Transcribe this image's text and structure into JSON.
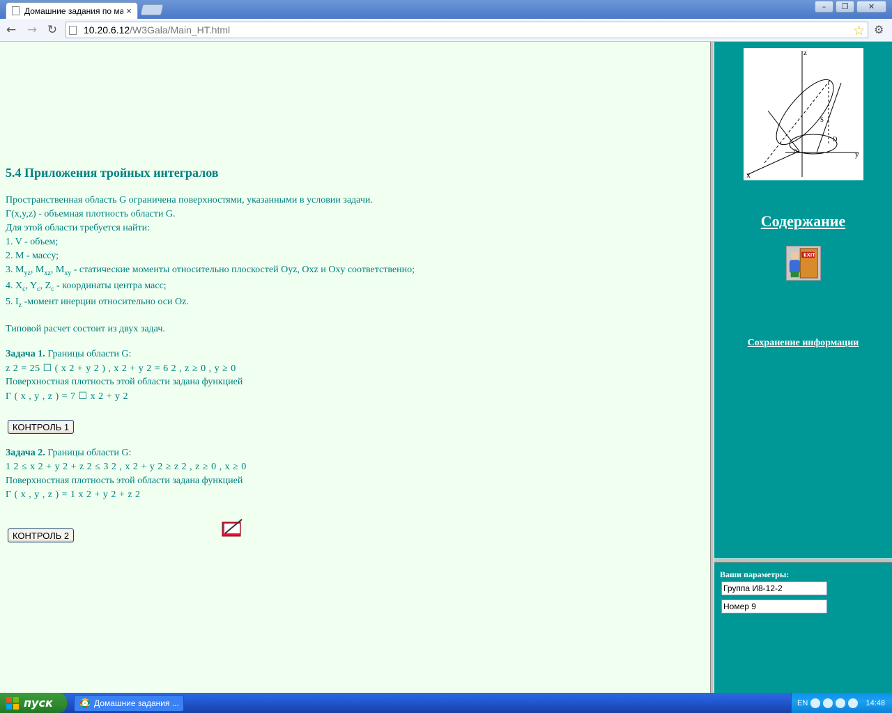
{
  "browser": {
    "tab_title": "Домашние задания по мате",
    "tab_close": "×",
    "url_host": "10.20.6.12",
    "url_path": "/W3Gala/Main_HT.html",
    "window_buttons": [
      "–",
      "❐",
      "✕"
    ]
  },
  "main": {
    "heading": "5.4 Приложения тройных интегралов",
    "intro": [
      "Пространственная область G ограничена поверхностями, указанными в условии задачи.",
      "Г(x,y,z) - объемная плотность области G.",
      "Для этой области требуется найти:",
      "1. V - объем;",
      "2. M - массу;"
    ],
    "item3": {
      "prefix": "3. M",
      "s1": "yz",
      "mid1": ", M",
      "s2": "xz",
      "mid2": ", M",
      "s3": "xy",
      "suffix": " - статические моменты относительно плоскостей Oyz, Oxz и Oxy соответственно;"
    },
    "item4": {
      "prefix": "4. X",
      "s1": "c",
      "mid1": ", Y",
      "s2": "c",
      "mid2": ", Z",
      "s3": "c",
      "suffix": " - координаты центра масс;"
    },
    "item5": {
      "prefix": "5. I",
      "s1": "z",
      "suffix": " -момент инерции относительно оси Oz."
    },
    "summary": "Типовой расчет состоит из двух задач.",
    "task1": {
      "label": "Задача 1.",
      "boundary_text": " Границы области G:",
      "equation": "z 2 = 25 ☐ ( x 2 + y 2 ) ,     x 2 + y 2 = 6 2 ,     z ≥ 0 ,     y ≥ 0",
      "density_text": "Поверхностная плотность этой области задана функцией",
      "density": "Г ( x , y , z ) = 7 ☐ x 2 + y 2",
      "button": "КОНТРОЛЬ 1"
    },
    "task2": {
      "label": "Задача 2.",
      "boundary_text": " Границы области G:",
      "equation": "1 2 ≤ x 2 + y 2 + z 2 ≤ 3 2 ,     x 2 + y 2 ≥ z 2 ,     z ≥ 0 ,     x ≥ 0",
      "density_text": "Поверхностная плотность этой области задана функцией",
      "density": "Г ( x , y , z ) = 1 x 2 + y 2 + z 2",
      "button": "КОНТРОЛЬ 2"
    }
  },
  "sidebar": {
    "contents_link": "Содержание",
    "exit_label": "EXIT",
    "save_link": "Сохранение информации",
    "graph_labels": {
      "z": "z",
      "y": "y",
      "x": "x",
      "o": "o",
      "d": "D",
      "s": "S"
    }
  },
  "params": {
    "label": "Ваши параметры:",
    "group": "Группа И8-12-2",
    "number": "Номер 9"
  },
  "taskbar": {
    "start": "пуск",
    "task": "Домашние задания ...",
    "lang": "EN",
    "clock": "14:48"
  },
  "colors": {
    "accent": "#008080",
    "sidebar_bg": "#009797",
    "main_bg": "#f0fff0"
  }
}
